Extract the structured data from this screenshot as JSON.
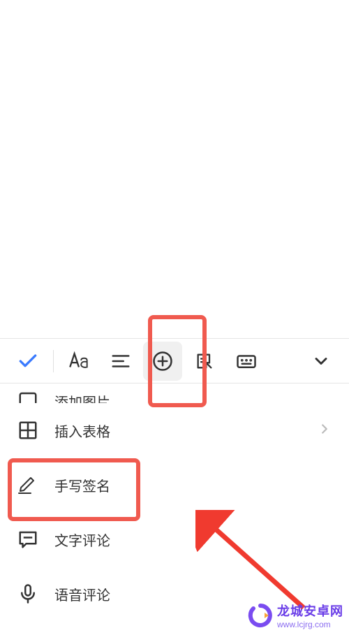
{
  "toolbar": {
    "confirm": "confirm",
    "textStyle": "text-style",
    "paragraph": "paragraph",
    "insert": "insert",
    "note": "note",
    "keyboard": "keyboard",
    "collapse": "collapse"
  },
  "menu": {
    "partial": "添加图片",
    "insertTable": "插入表格",
    "handwrittenSignature": "手写签名",
    "textComment": "文字评论",
    "voiceComment": "语音评论"
  },
  "watermark": {
    "title": "龙城安卓网",
    "url": "www.lcjrg.com"
  }
}
